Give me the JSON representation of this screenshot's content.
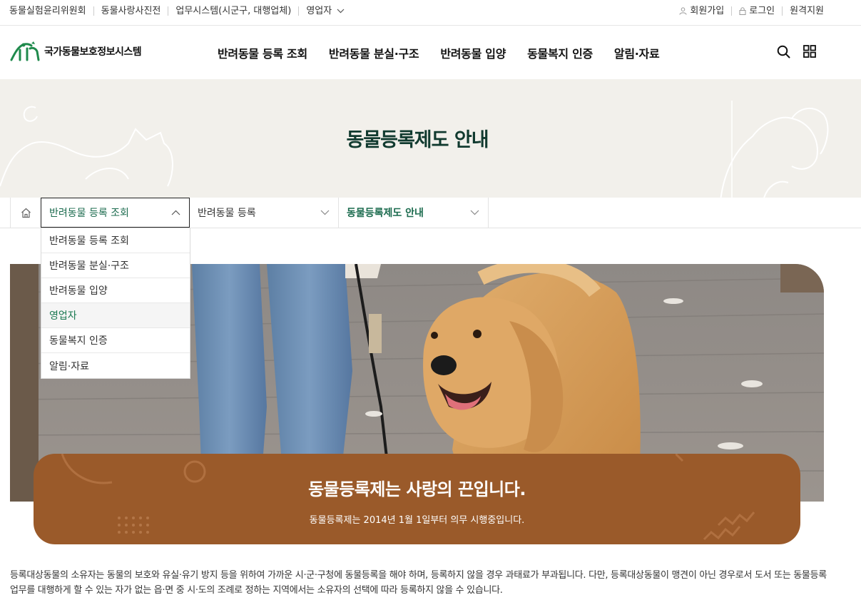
{
  "utility_bar": {
    "left_links": [
      "동물실험윤리위원회",
      "동물사랑사진전",
      "업무시스템(시군구, 대행업체)",
      "영업자"
    ],
    "right_links": {
      "signup": "회원가입",
      "login": "로그인",
      "remote_support": "원격지원"
    }
  },
  "header": {
    "logo_text": "국가동물보호정보시스템",
    "nav": [
      "반려동물 등록 조회",
      "반려동물 분실·구조",
      "반려동물 입양",
      "동물복지 인증",
      "알림·자료"
    ]
  },
  "visual": {
    "title": "동물등록제도 안내"
  },
  "breadcrumb": {
    "level1": "반려동물 등록 조회",
    "level2": "반려동물 등록",
    "level3": "동물등록제도 안내"
  },
  "dropdown": {
    "options": [
      "반려동물 등록 조회",
      "반려동물 분실·구조",
      "반려동물 입양",
      "영업자",
      "동물복지 인증",
      "알림·자료"
    ],
    "highlighted": "영업자"
  },
  "banner": {
    "headline": "동물등록제는 사랑의 끈입니다.",
    "subtext": "동물등록제는 2014년 1월 1일부터 의무 시행중입니다."
  },
  "content": {
    "paragraph": "등록대상동물의 소유자는 동물의 보호와 유실·유기 방지 등을 위하여 가까운 시·군·구청에 동물등록을 해야 하며, 등록하지 않을 경우 과태료가 부과됩니다. 다만, 등록대상동물이 맹견이 아닌 경우로서 도서 또는 동물등록 업무를 대행하게 할 수 있는 자가 없는 읍·면 중 시·도의 조례로 정하는 지역에서는 소유자의 선택에 따라 등록하지 않을 수 있습니다."
  },
  "colors": {
    "brand_green": "#1b6b4e",
    "title_dark_green": "#113a2f",
    "banner_brown": "#9a5a2a",
    "visual_bg": "#f2f0eb"
  }
}
